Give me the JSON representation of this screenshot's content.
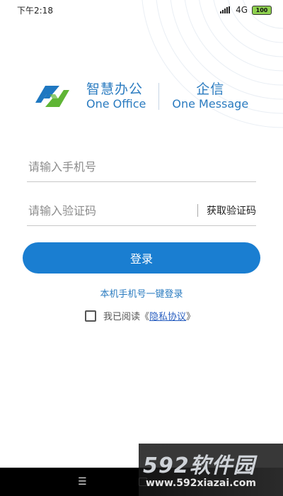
{
  "status_bar": {
    "time": "下午2:18",
    "network": "4G",
    "battery": "100"
  },
  "brand": {
    "product_cn": "智慧办公",
    "product_en": "One Office",
    "partner_cn": "企信",
    "partner_en": "One Message",
    "logo_icon": "link-logo-icon",
    "accent_color": "#2a7bc0"
  },
  "login_form": {
    "phone_placeholder": "请输入手机号",
    "code_placeholder": "请输入验证码",
    "get_code_label": "获取验证码",
    "login_label": "登录",
    "one_click_login": "本机手机号一键登录",
    "agreement_prefix": "我已阅读",
    "agreement_open": "《",
    "privacy_link": "隐私协议",
    "agreement_close": "》",
    "button_color": "#1a7ed1"
  },
  "nav_bar": {
    "menu_icon": "menu-icon",
    "menu_glyph": "☰",
    "home_icon": "home-icon"
  },
  "watermark": {
    "title": "592软件园",
    "url": "www.592xiazai.com"
  }
}
